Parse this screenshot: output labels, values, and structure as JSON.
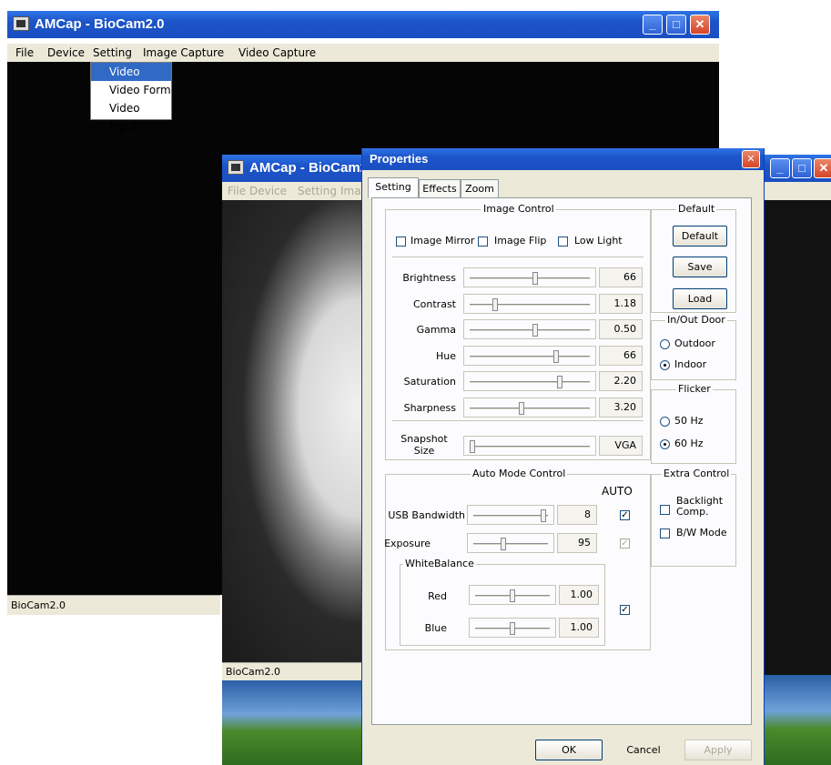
{
  "colors": {
    "titlebar": "#1c54c8",
    "menu_highlight": "#316ac5",
    "dialog_bg": "#ece9d8"
  },
  "back_window": {
    "title": "AMCap - BioCam2.0",
    "menu": [
      "File",
      "Device",
      "Setting",
      "Image Capture",
      "Video Capture"
    ],
    "dropdown": [
      "Video Fillter",
      "Video Form",
      "Video Input"
    ],
    "status": "BioCam2.0"
  },
  "mid_window": {
    "title": "AMCap - BioCam2.0",
    "menu": [
      "File",
      "Device",
      "Setting",
      "Ima"
    ],
    "status": "BioCam2.0"
  },
  "dialog": {
    "title": "Properties",
    "close_icon": "close-icon",
    "tabs": [
      "Setting",
      "Effects",
      "Zoom"
    ],
    "image_control": {
      "label": "Image Control",
      "checks": [
        "Image Mirror",
        "Image Flip",
        "Low Light"
      ],
      "sliders": [
        {
          "label": "Brightness",
          "value": "66",
          "pos": 0.55
        },
        {
          "label": "Contrast",
          "value": "1.18",
          "pos": 0.2
        },
        {
          "label": "Gamma",
          "value": "0.50",
          "pos": 0.55
        },
        {
          "label": "Hue",
          "value": "66",
          "pos": 0.73
        },
        {
          "label": "Saturation",
          "value": "2.20",
          "pos": 0.76
        },
        {
          "label": "Sharpness",
          "value": "3.20",
          "pos": 0.43
        }
      ],
      "snapshot_label": "Snapshot\nSize",
      "snapshot_value": "VGA",
      "snapshot_pos": 0.0
    },
    "default_group": {
      "label": "Default",
      "buttons": [
        "Default",
        "Save",
        "Load"
      ]
    },
    "in_out_door": {
      "label": "In/Out Door",
      "options": [
        "Outdoor",
        "Indoor"
      ],
      "selected": "Indoor"
    },
    "flicker": {
      "label": "Flicker",
      "options": [
        "50 Hz",
        "60 Hz"
      ],
      "selected": "60 Hz"
    },
    "auto_mode": {
      "label": "Auto Mode Control",
      "auto_header": "AUTO",
      "usb_bandwidth": {
        "label": "USB Bandwidth",
        "value": "8",
        "pos": 0.97,
        "auto": true
      },
      "exposure": {
        "label": "Exposure",
        "value": "95",
        "pos": 0.4,
        "auto": true
      },
      "white_balance": {
        "label": "WhiteBalance",
        "red": {
          "label": "Red",
          "value": "1.00",
          "pos": 0.5
        },
        "blue": {
          "label": "Blue",
          "value": "1.00",
          "pos": 0.5
        },
        "auto": true
      }
    },
    "extra_control": {
      "label": "Extra Control",
      "checks": [
        "Backlight\nComp.",
        "B/W Mode"
      ]
    },
    "buttons": {
      "ok": "OK",
      "cancel": "Cancel",
      "apply": "Apply"
    }
  }
}
